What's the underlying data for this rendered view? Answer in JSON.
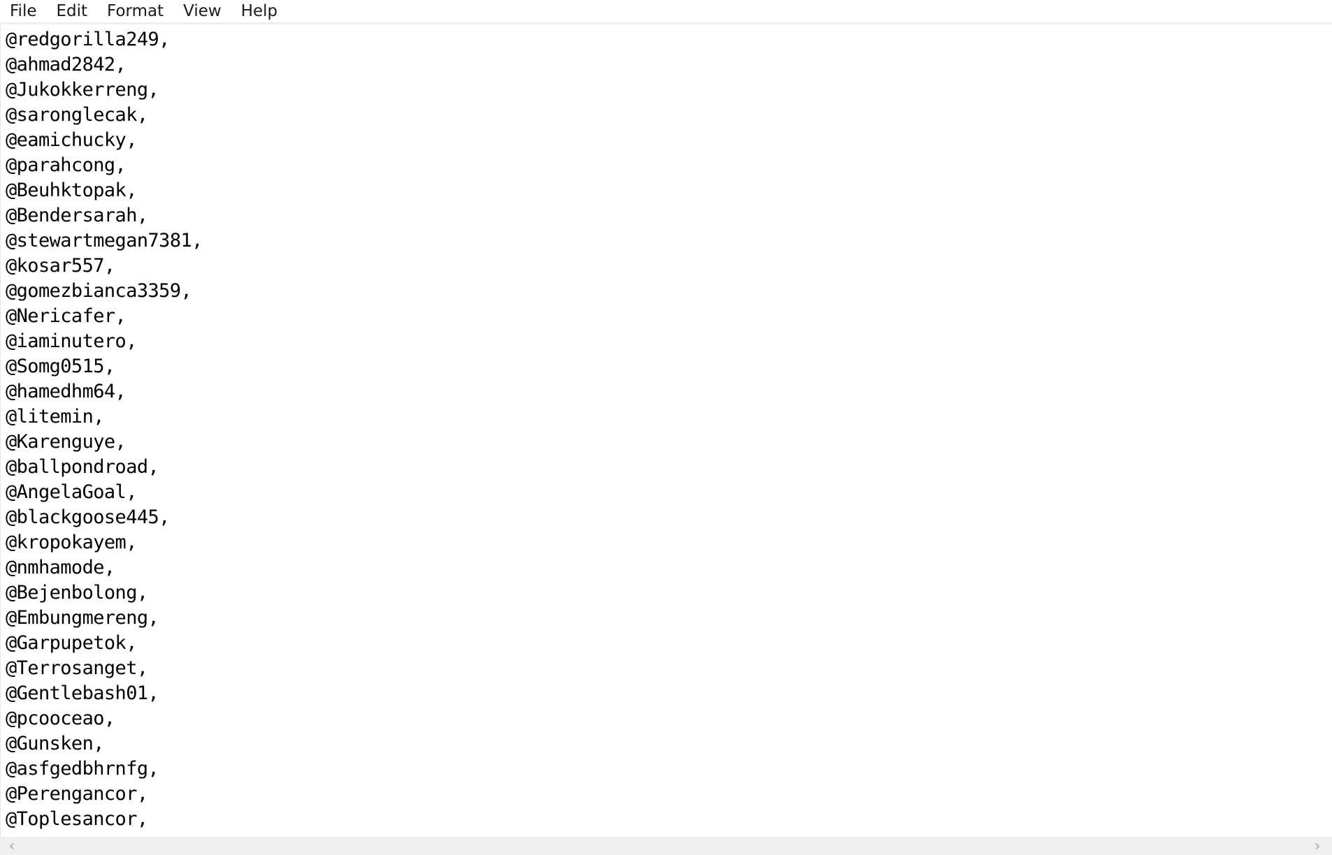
{
  "menubar": {
    "items": [
      "File",
      "Edit",
      "Format",
      "View",
      "Help"
    ]
  },
  "editor": {
    "lines": [
      "@redgorilla249,",
      "@ahmad2842,",
      "@Jukokkerreng,",
      "@saronglecak,",
      "@eamichucky,",
      "@parahcong,",
      "@Beuhktopak,",
      "@Bendersarah,",
      "@stewartmegan7381,",
      "@kosar557,",
      "@gomezbianca3359,",
      "@Nericafer,",
      "@iaminutero,",
      "@Somg0515,",
      "@hamedhm64,",
      "@litemin,",
      "@Karenguye,",
      "@ballpondroad,",
      "@AngelaGoal,",
      "@blackgoose445,",
      "@kropokayem,",
      "@nmhamode,",
      "@Bejenbolong,",
      "@Embungmereng,",
      "@Garpupetok,",
      "@Terrosanget,",
      "@Gentlebash01,",
      "@pcooceao,",
      "@Gunsken,",
      "@asfgedbhrnfg,",
      "@Perengancor,",
      "@Toplesancor,"
    ]
  },
  "scrollbar": {
    "left_arrow": "‹",
    "right_arrow": "›"
  }
}
